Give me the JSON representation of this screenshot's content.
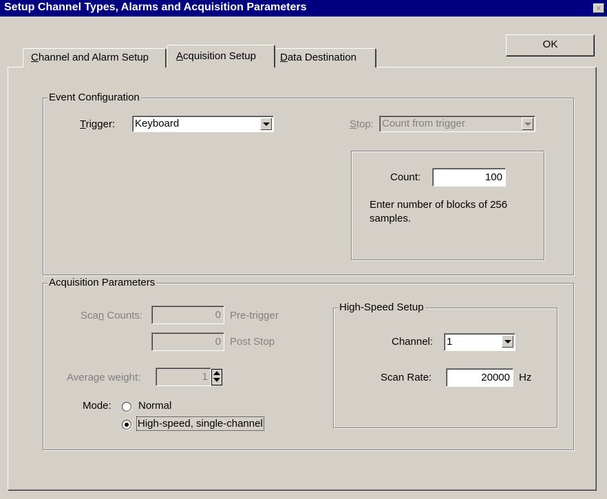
{
  "window": {
    "title": "Setup Channel Types, Alarms and Acquisition Parameters",
    "close_glyph": "×"
  },
  "ok_label": "OK",
  "tabs": [
    {
      "before": "",
      "accel": "C",
      "after": "hannel and Alarm Setup",
      "active": false
    },
    {
      "before": "",
      "accel": "A",
      "after": "cquisition Setup",
      "active": true
    },
    {
      "before": "",
      "accel": "D",
      "after": "ata Destination",
      "active": false
    }
  ],
  "event_config": {
    "title": "Event Configuration",
    "trigger_label_accel": "T",
    "trigger_label_rest": "rigger:",
    "trigger_value": "Keyboard",
    "stop_label_accel": "S",
    "stop_label_rest": "top:",
    "stop_value": "Count from trigger",
    "count_label": "Count:",
    "count_value": "100",
    "count_help_1": "Enter number of blocks of 256",
    "count_help_2": "samples."
  },
  "acquisition": {
    "title": "Acquisition Parameters",
    "scan_counts_before": "Sca",
    "scan_counts_accel": "n",
    "scan_counts_after": " Counts:",
    "pre_trigger_value": "0",
    "pre_trigger_label": "Pre-trigger",
    "post_stop_value": "0",
    "post_stop_label": "Post Stop",
    "average_weight_label": "Average weight:",
    "average_weight_value": "1",
    "mode_label": "Mode:",
    "mode_normal": "Normal",
    "mode_highspeed": "High-speed, single-channel",
    "mode_selected": "High-speed, single-channel"
  },
  "high_speed": {
    "title": "High-Speed Setup",
    "channel_label": "Channel:",
    "channel_value": "1",
    "scan_rate_label": "Scan Rate:",
    "scan_rate_value": "20000",
    "scan_rate_unit": "Hz"
  }
}
